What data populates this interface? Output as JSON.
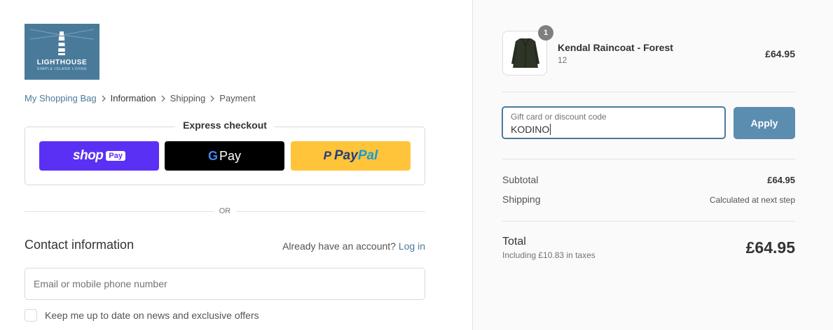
{
  "logo": {
    "brand": "LIGHTHOUSE",
    "tagline": "SIMPLE ISLAND LIVING"
  },
  "breadcrumb": {
    "items": [
      {
        "label": "My Shopping Bag"
      },
      {
        "label": "Information"
      },
      {
        "label": "Shipping"
      },
      {
        "label": "Payment"
      }
    ]
  },
  "express": {
    "title": "Express checkout",
    "shop_pay": {
      "word": "shop",
      "pill": "Pay"
    },
    "google_pay": {
      "g": "G",
      "word": "Pay"
    },
    "paypal": {
      "mark": "P",
      "word1": "Pay",
      "word2": "Pal"
    }
  },
  "divider": {
    "label": "OR"
  },
  "contact": {
    "heading": "Contact information",
    "account_prompt": "Already have an account?",
    "login_label": "Log in",
    "email_placeholder": "Email or mobile phone number",
    "newsletter_label": "Keep me up to date on news and exclusive offers"
  },
  "cart": {
    "quantity": "1",
    "product_name": "Kendal Raincoat - Forest",
    "variant": "12",
    "price": "£64.95"
  },
  "discount": {
    "label": "Gift card or discount code",
    "value": "KODINO",
    "apply_label": "Apply"
  },
  "summary": {
    "subtotal_label": "Subtotal",
    "subtotal_value": "£64.95",
    "shipping_label": "Shipping",
    "shipping_value": "Calculated at next step",
    "total_label": "Total",
    "tax_note": "Including £10.83 in taxes",
    "total_value": "£64.95"
  },
  "colors": {
    "accent": "#4a7a9a",
    "apply_button": "#5b8db0",
    "shop_pay": "#5a31f4",
    "google_pay": "#000000",
    "paypal": "#ffc439"
  }
}
